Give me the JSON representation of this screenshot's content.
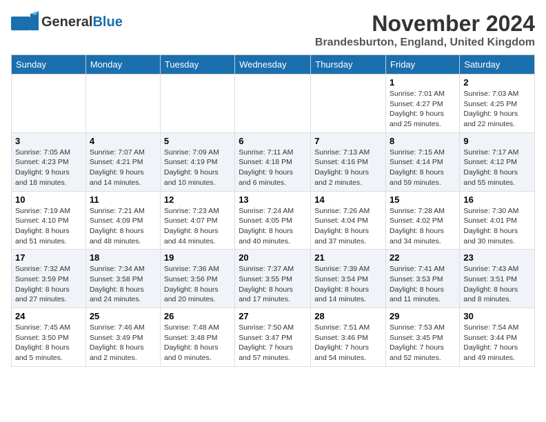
{
  "header": {
    "logo_general": "General",
    "logo_blue": "Blue",
    "month": "November 2024",
    "location": "Brandesburton, England, United Kingdom"
  },
  "weekdays": [
    "Sunday",
    "Monday",
    "Tuesday",
    "Wednesday",
    "Thursday",
    "Friday",
    "Saturday"
  ],
  "weeks": [
    [
      {
        "day": "",
        "info": ""
      },
      {
        "day": "",
        "info": ""
      },
      {
        "day": "",
        "info": ""
      },
      {
        "day": "",
        "info": ""
      },
      {
        "day": "",
        "info": ""
      },
      {
        "day": "1",
        "info": "Sunrise: 7:01 AM\nSunset: 4:27 PM\nDaylight: 9 hours and 25 minutes."
      },
      {
        "day": "2",
        "info": "Sunrise: 7:03 AM\nSunset: 4:25 PM\nDaylight: 9 hours and 22 minutes."
      }
    ],
    [
      {
        "day": "3",
        "info": "Sunrise: 7:05 AM\nSunset: 4:23 PM\nDaylight: 9 hours and 18 minutes."
      },
      {
        "day": "4",
        "info": "Sunrise: 7:07 AM\nSunset: 4:21 PM\nDaylight: 9 hours and 14 minutes."
      },
      {
        "day": "5",
        "info": "Sunrise: 7:09 AM\nSunset: 4:19 PM\nDaylight: 9 hours and 10 minutes."
      },
      {
        "day": "6",
        "info": "Sunrise: 7:11 AM\nSunset: 4:18 PM\nDaylight: 9 hours and 6 minutes."
      },
      {
        "day": "7",
        "info": "Sunrise: 7:13 AM\nSunset: 4:16 PM\nDaylight: 9 hours and 2 minutes."
      },
      {
        "day": "8",
        "info": "Sunrise: 7:15 AM\nSunset: 4:14 PM\nDaylight: 8 hours and 59 minutes."
      },
      {
        "day": "9",
        "info": "Sunrise: 7:17 AM\nSunset: 4:12 PM\nDaylight: 8 hours and 55 minutes."
      }
    ],
    [
      {
        "day": "10",
        "info": "Sunrise: 7:19 AM\nSunset: 4:10 PM\nDaylight: 8 hours and 51 minutes."
      },
      {
        "day": "11",
        "info": "Sunrise: 7:21 AM\nSunset: 4:09 PM\nDaylight: 8 hours and 48 minutes."
      },
      {
        "day": "12",
        "info": "Sunrise: 7:23 AM\nSunset: 4:07 PM\nDaylight: 8 hours and 44 minutes."
      },
      {
        "day": "13",
        "info": "Sunrise: 7:24 AM\nSunset: 4:05 PM\nDaylight: 8 hours and 40 minutes."
      },
      {
        "day": "14",
        "info": "Sunrise: 7:26 AM\nSunset: 4:04 PM\nDaylight: 8 hours and 37 minutes."
      },
      {
        "day": "15",
        "info": "Sunrise: 7:28 AM\nSunset: 4:02 PM\nDaylight: 8 hours and 34 minutes."
      },
      {
        "day": "16",
        "info": "Sunrise: 7:30 AM\nSunset: 4:01 PM\nDaylight: 8 hours and 30 minutes."
      }
    ],
    [
      {
        "day": "17",
        "info": "Sunrise: 7:32 AM\nSunset: 3:59 PM\nDaylight: 8 hours and 27 minutes."
      },
      {
        "day": "18",
        "info": "Sunrise: 7:34 AM\nSunset: 3:58 PM\nDaylight: 8 hours and 24 minutes."
      },
      {
        "day": "19",
        "info": "Sunrise: 7:36 AM\nSunset: 3:56 PM\nDaylight: 8 hours and 20 minutes."
      },
      {
        "day": "20",
        "info": "Sunrise: 7:37 AM\nSunset: 3:55 PM\nDaylight: 8 hours and 17 minutes."
      },
      {
        "day": "21",
        "info": "Sunrise: 7:39 AM\nSunset: 3:54 PM\nDaylight: 8 hours and 14 minutes."
      },
      {
        "day": "22",
        "info": "Sunrise: 7:41 AM\nSunset: 3:53 PM\nDaylight: 8 hours and 11 minutes."
      },
      {
        "day": "23",
        "info": "Sunrise: 7:43 AM\nSunset: 3:51 PM\nDaylight: 8 hours and 8 minutes."
      }
    ],
    [
      {
        "day": "24",
        "info": "Sunrise: 7:45 AM\nSunset: 3:50 PM\nDaylight: 8 hours and 5 minutes."
      },
      {
        "day": "25",
        "info": "Sunrise: 7:46 AM\nSunset: 3:49 PM\nDaylight: 8 hours and 2 minutes."
      },
      {
        "day": "26",
        "info": "Sunrise: 7:48 AM\nSunset: 3:48 PM\nDaylight: 8 hours and 0 minutes."
      },
      {
        "day": "27",
        "info": "Sunrise: 7:50 AM\nSunset: 3:47 PM\nDaylight: 7 hours and 57 minutes."
      },
      {
        "day": "28",
        "info": "Sunrise: 7:51 AM\nSunset: 3:46 PM\nDaylight: 7 hours and 54 minutes."
      },
      {
        "day": "29",
        "info": "Sunrise: 7:53 AM\nSunset: 3:45 PM\nDaylight: 7 hours and 52 minutes."
      },
      {
        "day": "30",
        "info": "Sunrise: 7:54 AM\nSunset: 3:44 PM\nDaylight: 7 hours and 49 minutes."
      }
    ]
  ]
}
